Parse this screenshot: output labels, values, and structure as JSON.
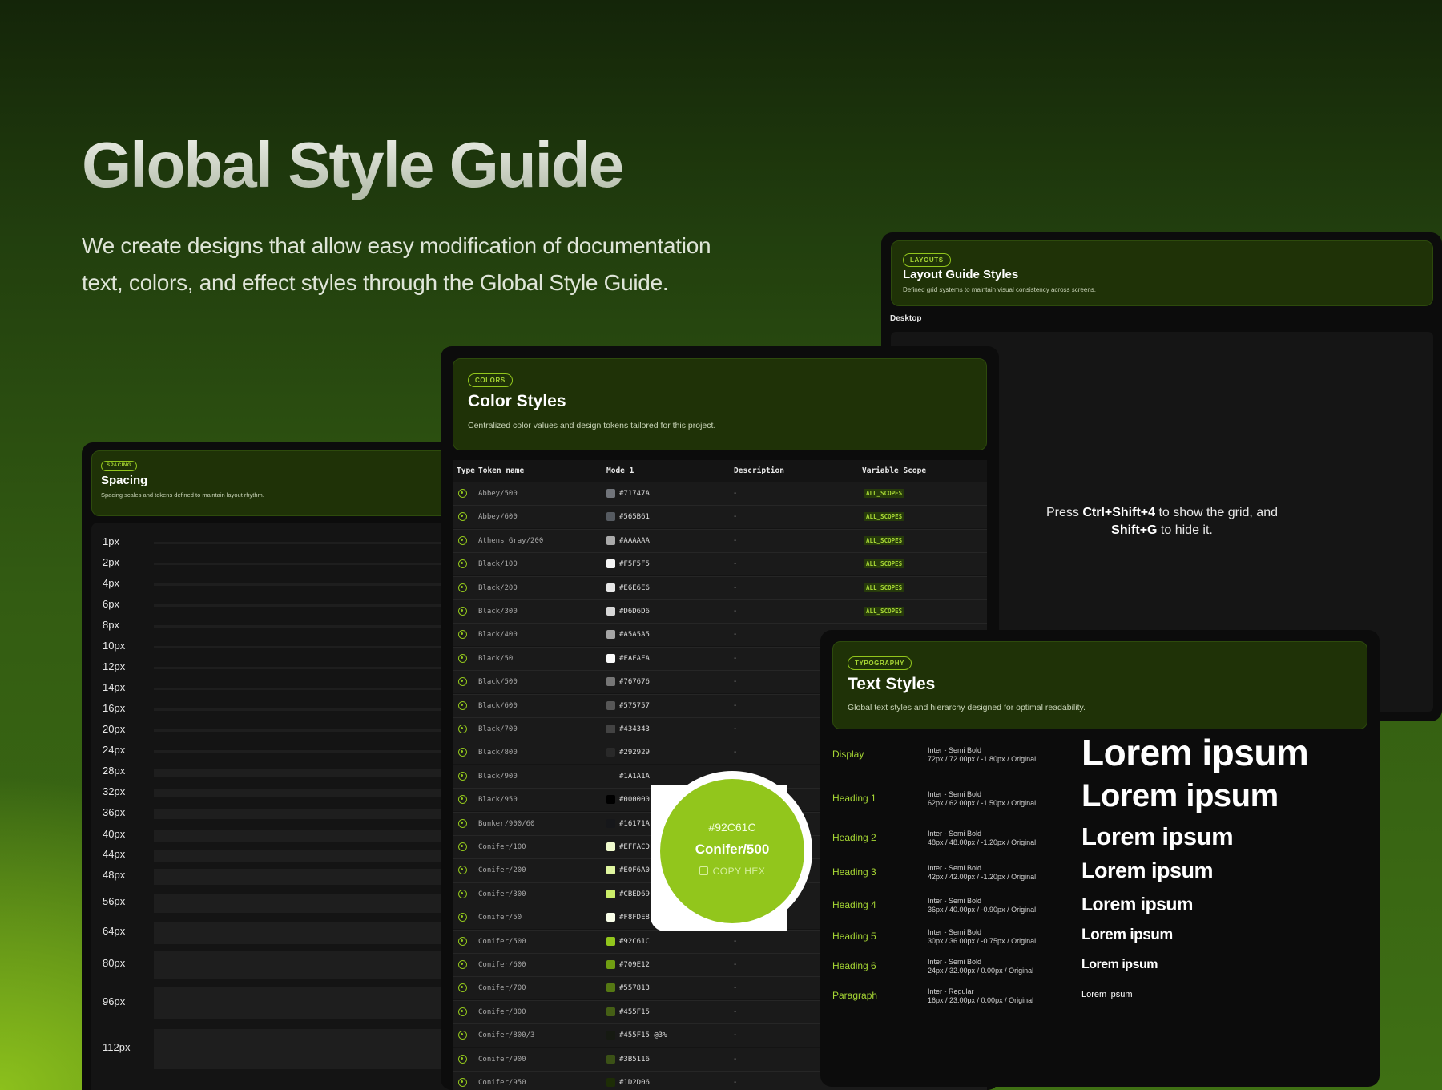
{
  "hero": {
    "title": "Global Style Guide",
    "subtitle": "We create designs that allow easy modification of documentation text, colors, and effect styles through the Global Style Guide."
  },
  "layout_panel": {
    "badge": "LAYOUTS",
    "title": "Layout Guide Styles",
    "description": "Defined grid systems to maintain visual consistency across screens.",
    "section_label": "Desktop",
    "hint_before": "Press ",
    "hint_key1": "Ctrl+Shift+4",
    "hint_mid": " to show the grid, and ",
    "hint_key2": "Shift+G",
    "hint_after": " to hide it."
  },
  "spacing_panel": {
    "badge": "SPACING",
    "title": "Spacing",
    "description": "Spacing scales and tokens defined to maintain layout rhythm.",
    "items": [
      "1px",
      "2px",
      "4px",
      "6px",
      "8px",
      "10px",
      "12px",
      "14px",
      "16px",
      "20px",
      "24px",
      "28px",
      "32px",
      "36px",
      "40px",
      "44px",
      "48px",
      "56px",
      "64px",
      "80px",
      "96px",
      "112px"
    ]
  },
  "colors_panel": {
    "badge": "COLORS",
    "title": "Color Styles",
    "description": "Centralized color values and design tokens tailored for this project.",
    "columns": {
      "type": "Type",
      "token": "Token name",
      "mode": "Mode 1",
      "description": "Description",
      "scope": "Variable Scope"
    },
    "rows": [
      {
        "token": "Abbey/500",
        "hex": "#71747A",
        "swatch": "#71747A",
        "desc": "-",
        "scope": "ALL_SCOPES"
      },
      {
        "token": "Abbey/600",
        "hex": "#565B61",
        "swatch": "#565B61",
        "desc": "-",
        "scope": "ALL_SCOPES"
      },
      {
        "token": "Athens Gray/200",
        "hex": "#AAAAAA",
        "swatch": "#AAAAAA",
        "desc": "-",
        "scope": "ALL_SCOPES"
      },
      {
        "token": "Black/100",
        "hex": "#F5F5F5",
        "swatch": "#F5F5F5",
        "desc": "-",
        "scope": "ALL_SCOPES"
      },
      {
        "token": "Black/200",
        "hex": "#E6E6E6",
        "swatch": "#E6E6E6",
        "desc": "-",
        "scope": "ALL_SCOPES"
      },
      {
        "token": "Black/300",
        "hex": "#D6D6D6",
        "swatch": "#D6D6D6",
        "desc": "-",
        "scope": "ALL_SCOPES"
      },
      {
        "token": "Black/400",
        "hex": "#A5A5A5",
        "swatch": "#A5A5A5",
        "desc": "-",
        "scope": ""
      },
      {
        "token": "Black/50",
        "hex": "#FAFAFA",
        "swatch": "#FAFAFA",
        "desc": "-",
        "scope": ""
      },
      {
        "token": "Black/500",
        "hex": "#767676",
        "swatch": "#767676",
        "desc": "-",
        "scope": ""
      },
      {
        "token": "Black/600",
        "hex": "#575757",
        "swatch": "#575757",
        "desc": "-",
        "scope": ""
      },
      {
        "token": "Black/700",
        "hex": "#434343",
        "swatch": "#434343",
        "desc": "-",
        "scope": ""
      },
      {
        "token": "Black/800",
        "hex": "#292929",
        "swatch": "#292929",
        "desc": "-",
        "scope": ""
      },
      {
        "token": "Black/900",
        "hex": "#1A1A1A",
        "swatch": "#1A1A1A",
        "desc": "-",
        "scope": ""
      },
      {
        "token": "Black/950",
        "hex": "#000000",
        "swatch": "#000000",
        "desc": "-",
        "scope": ""
      },
      {
        "token": "Bunker/900/60",
        "hex": "#16171A",
        "swatch": "#16171A",
        "desc": "",
        "scope": ""
      },
      {
        "token": "Conifer/100",
        "hex": "#EFFACD",
        "swatch": "#EFFACD",
        "desc": "",
        "scope": ""
      },
      {
        "token": "Conifer/200",
        "hex": "#E0F6A0",
        "swatch": "#E0F6A0",
        "desc": "",
        "scope": ""
      },
      {
        "token": "Conifer/300",
        "hex": "#CBED69",
        "swatch": "#CBED69",
        "desc": "",
        "scope": ""
      },
      {
        "token": "Conifer/50",
        "hex": "#F8FDE8",
        "swatch": "#F8FDE8",
        "desc": "",
        "scope": ""
      },
      {
        "token": "Conifer/500",
        "hex": "#92C61C",
        "swatch": "#92C61C",
        "desc": "-",
        "scope": ""
      },
      {
        "token": "Conifer/600",
        "hex": "#709E12",
        "swatch": "#709E12",
        "desc": "-",
        "scope": ""
      },
      {
        "token": "Conifer/700",
        "hex": "#557813",
        "swatch": "#557813",
        "desc": "-",
        "scope": ""
      },
      {
        "token": "Conifer/800",
        "hex": "#455F15",
        "swatch": "#455F15",
        "desc": "-",
        "scope": ""
      },
      {
        "token": "Conifer/800/3",
        "hex": "#455F15 @3%",
        "swatch": "#161a12",
        "desc": "-",
        "scope": ""
      },
      {
        "token": "Conifer/900",
        "hex": "#3B5116",
        "swatch": "#3B5116",
        "desc": "-",
        "scope": ""
      },
      {
        "token": "Conifer/950",
        "hex": "#1D2D06",
        "swatch": "#1D2D06",
        "desc": "-",
        "scope": ""
      }
    ],
    "popup": {
      "hex": "#92C61C",
      "name": "Conifer/500",
      "copy_label": "COPY HEX"
    }
  },
  "text_panel": {
    "badge": "TYPOGRAPHY",
    "title": "Text Styles",
    "description": "Global text styles and hierarchy designed for optimal readability.",
    "rows": [
      {
        "name": "Display",
        "font": "Inter - Semi Bold",
        "spec": "72px / 72.00px / -1.80px / Original",
        "sample": "Lorem ipsum"
      },
      {
        "name": "Heading 1",
        "font": "Inter - Semi Bold",
        "spec": "62px / 62.00px / -1.50px / Original",
        "sample": "Lorem ipsum"
      },
      {
        "name": "Heading 2",
        "font": "Inter - Semi Bold",
        "spec": "48px / 48.00px / -1.20px / Original",
        "sample": "Lorem ipsum"
      },
      {
        "name": "Heading 3",
        "font": "Inter - Semi Bold",
        "spec": "42px / 42.00px / -1.20px / Original",
        "sample": "Lorem ipsum"
      },
      {
        "name": "Heading 4",
        "font": "Inter - Semi Bold",
        "spec": "36px / 40.00px / -0.90px / Original",
        "sample": "Lorem ipsum"
      },
      {
        "name": "Heading 5",
        "font": "Inter - Semi Bold",
        "spec": "30px / 36.00px / -0.75px / Original",
        "sample": "Lorem ipsum"
      },
      {
        "name": "Heading 6",
        "font": "Inter - Semi Bold",
        "spec": "24px / 32.00px / 0.00px / Original",
        "sample": "Lorem ipsum"
      },
      {
        "name": "Paragraph",
        "font": "Inter - Regular",
        "spec": "16px / 23.00px / 0.00px / Original",
        "sample": "Lorem ipsum"
      }
    ]
  }
}
